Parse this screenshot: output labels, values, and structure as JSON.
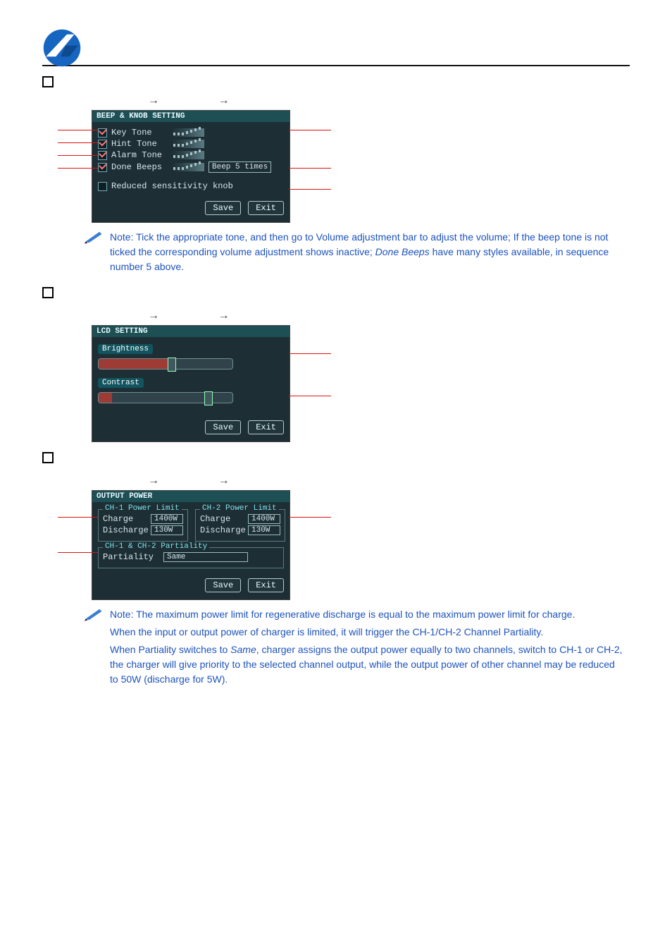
{
  "crumb_sep": "→",
  "beep_panel": {
    "title": "BEEP & KNOB SETTING",
    "items": {
      "key": "Key Tone",
      "hint": "Hint Tone",
      "alarm": "Alarm Tone",
      "done": "Done Beeps"
    },
    "done_value": "Beep 5 times",
    "reduced": "Reduced sensitivity knob",
    "save": "Save",
    "exit": "Exit"
  },
  "note1": "Note: Tick the appropriate tone, and then go to Volume adjustment bar to adjust the volume; If the beep tone is not ticked the corresponding volume adjustment shows inactive; ",
  "note1_em": "Done Beeps",
  "note1_tail": " have many styles available, in sequence number 5 above.",
  "lcd_panel": {
    "title": "LCD SETTING",
    "brightness": "Brightness",
    "contrast": "Contrast",
    "save": "Save",
    "exit": "Exit"
  },
  "output_panel": {
    "title": "OUTPUT POWER",
    "ch1_legend": "CH-1 Power Limit",
    "ch2_legend": "CH-2 Power Limit",
    "charge": "Charge",
    "discharge": "Discharge",
    "charge_val": "1400W",
    "discharge_val": "130W",
    "part_legend": "CH-1 & CH-2 Partiality",
    "partiality": "Partiality",
    "partiality_val": "Same",
    "save": "Save",
    "exit": "Exit"
  },
  "note2_a": "Note: The maximum power limit for regenerative discharge is equal to the maximum power limit for charge.",
  "note2_b": "When the input or output power of charger is limited, it will trigger the CH-1/CH-2 Channel Partiality.",
  "note2_c1": "When Partiality switches to ",
  "note2_c_em": "Same",
  "note2_c2": ", charger assigns the output power equally to two channels, switch to CH-1 or CH-2, the charger will give priority to the selected channel output, while the output power of other channel may be reduced to 50W (discharge for 5W)."
}
